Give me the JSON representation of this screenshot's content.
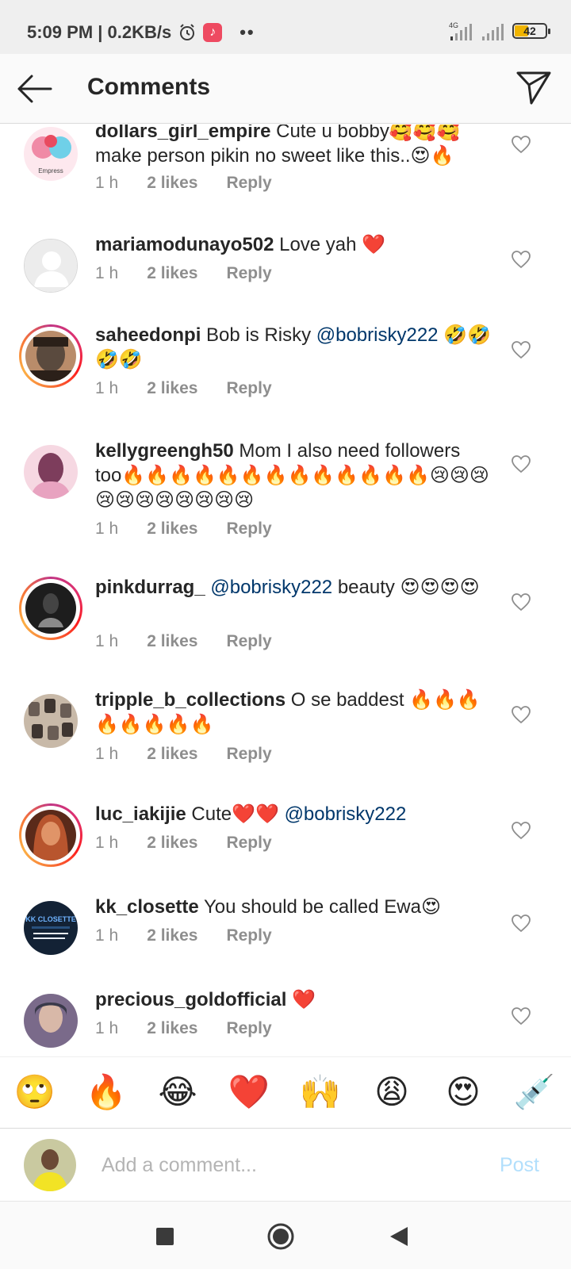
{
  "status_bar": {
    "time_speed": "5:09 PM | 0.2KB/s",
    "network": "4G",
    "battery": "42",
    "battery_level": 0.42
  },
  "header": {
    "title": "Comments",
    "back_icon": "arrow-left-icon",
    "share_icon": "send-icon"
  },
  "comments": [
    {
      "username": "dollars_girl_empire",
      "text": "Cute u bobby🥰🥰🥰 make person pikin no sweet like this..😍🔥",
      "mention": "",
      "time": "1 h",
      "likes": "2 likes",
      "reply": "Reply",
      "avatar_badge": "Empress",
      "colors": [
        "#f08aa6",
        "#6fd0e8",
        "#e84a5f"
      ]
    },
    {
      "username": "mariamodunayo502",
      "text": "Love yah ❤️",
      "mention": "",
      "time": "1 h",
      "likes": "2 likes",
      "reply": "Reply",
      "colors": [
        "#ededed",
        "#d5d5d5",
        "#ffffff"
      ]
    },
    {
      "username": "saheedonpi",
      "text": "Bob is Risky",
      "mention": "@bobrisky222",
      "text_after": "🤣🤣🤣🤣",
      "time": "1 h",
      "likes": "2 likes",
      "reply": "Reply",
      "colors": [
        "#5a4a3e",
        "#2b2019",
        "#b98c6a"
      ]
    },
    {
      "username": "kellygreengh50",
      "text": "Mom I also need followers too🔥🔥🔥🔥🔥🔥🔥🔥🔥🔥🔥🔥🔥😢😢😢😢😢😢😢😢😢😢😢",
      "mention": "",
      "time": "1 h",
      "likes": "2 likes",
      "reply": "Reply",
      "colors": [
        "#e8a3c0",
        "#7d3d5c",
        "#f6d8e2"
      ]
    },
    {
      "username": "pinkdurrag_",
      "text": "",
      "mention": "@bobrisky222",
      "text_after": "beauty 😍😍😍😍",
      "time": "1 h",
      "likes": "2 likes",
      "reply": "Reply",
      "colors": [
        "#1d1d1d",
        "#444444",
        "#8a8a8a"
      ]
    },
    {
      "username": "tripple_b_collections",
      "text": "O se baddest 🔥🔥🔥🔥🔥🔥🔥🔥",
      "mention": "",
      "time": "1 h",
      "likes": "2 likes",
      "reply": "Reply",
      "colors": [
        "#6a5d55",
        "#c8b9a8",
        "#3e3530"
      ]
    },
    {
      "username": "luc_iakijie",
      "text": "Cute❤️❤️",
      "mention": "@bobrisky222",
      "time": "1 h",
      "likes": "2 likes",
      "reply": "Reply",
      "colors": [
        "#b8552e",
        "#e09468",
        "#5a2a1a"
      ]
    },
    {
      "username": "kk_closette",
      "text": "You should be called Ewa😍",
      "mention": "",
      "time": "1 h",
      "likes": "2 likes",
      "reply": "Reply",
      "avatar_badge": "KK CLOSETTE",
      "colors": [
        "#132235",
        "#28507d",
        "#e8eef5"
      ]
    },
    {
      "username": "precious_goldofficial",
      "text": "❤️",
      "mention": "",
      "time": "1 h",
      "likes": "2 likes",
      "reply": "Reply",
      "colors": [
        "#3a3a4a",
        "#d8b8a8",
        "#7a6a8a"
      ]
    }
  ],
  "emoji_bar": [
    "🙄",
    "🔥",
    "😂",
    "❤️",
    "🙌",
    "😩",
    "😍",
    "💉"
  ],
  "composer": {
    "placeholder": "Add a comment...",
    "post_label": "Post"
  },
  "nav": {
    "icons": [
      "recents-square-icon",
      "home-circle-icon",
      "back-triangle-icon"
    ]
  },
  "colors": {
    "text": "#262626",
    "meta": "#8e8e8e",
    "mention": "#00376b",
    "post_disabled": "#b2dffc",
    "heart": "#ed4956"
  }
}
